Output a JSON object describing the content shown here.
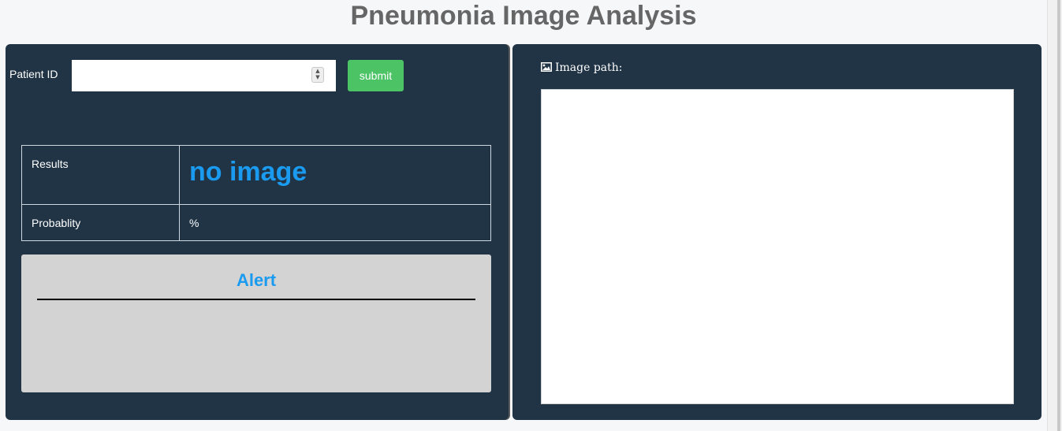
{
  "header": {
    "title": "Pneumonia Image Analysis"
  },
  "form": {
    "patient_id_label": "Patient ID",
    "patient_id_value": "",
    "submit_label": "submit"
  },
  "results_table": {
    "rows": [
      {
        "label": "Results",
        "value": "no image"
      },
      {
        "label": "Probablity",
        "value": "%"
      }
    ]
  },
  "alert": {
    "title": "Alert",
    "message": ""
  },
  "image_panel": {
    "label": "Image path:",
    "icon": "image-icon"
  },
  "colors": {
    "panel_bg": "#203446",
    "accent_blue": "#1a9bf0",
    "submit_green": "#4cc466",
    "alert_bg": "#d3d3d3",
    "title_gray": "#666666"
  }
}
